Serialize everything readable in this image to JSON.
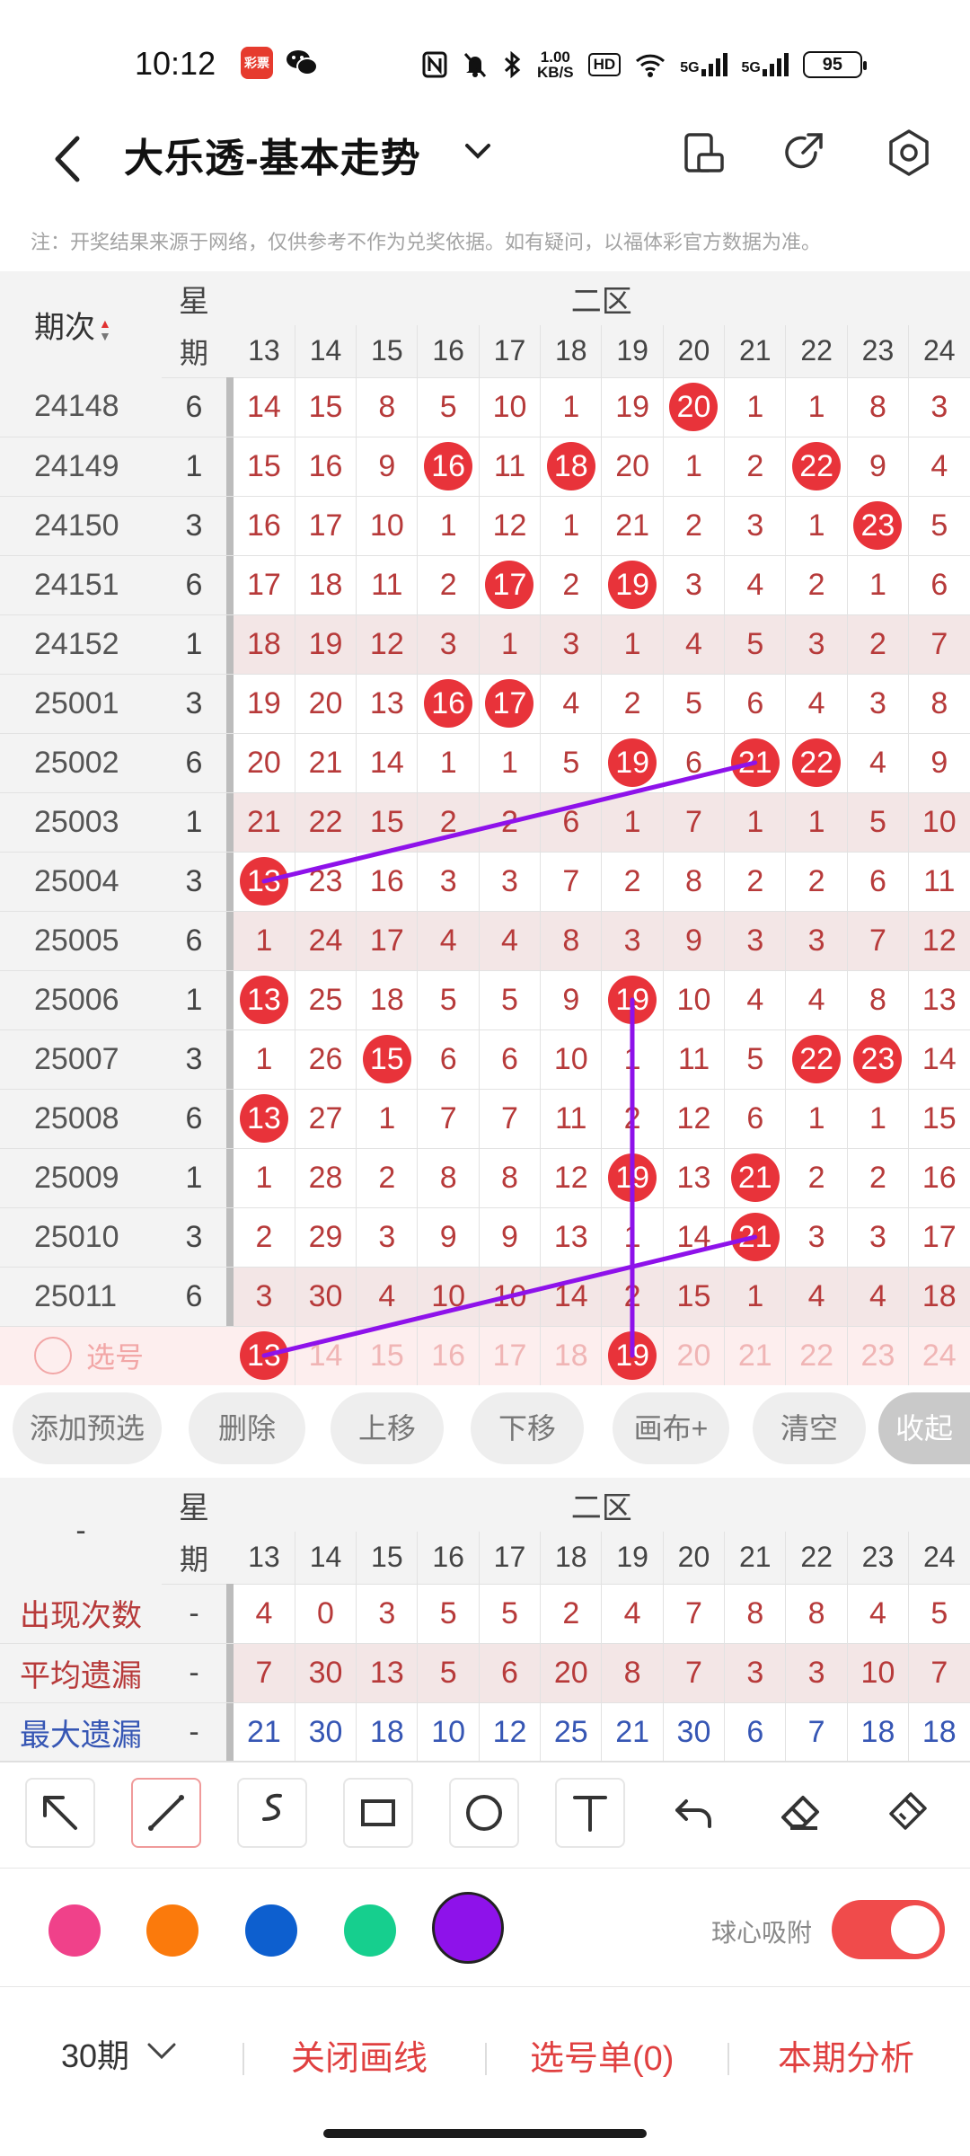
{
  "status": {
    "time": "10:12",
    "speed": "1.00",
    "speed_unit": "KB/S",
    "hd": "HD",
    "net1": "5G",
    "net2": "5G",
    "battery": "95",
    "app_icon_text": "彩票"
  },
  "header": {
    "title": "大乐透-基本走势"
  },
  "note": "注：开奖结果来源于网络，仅供参考不作为兑奖依据。如有疑问，以福体彩官方数据为准。",
  "grid": {
    "issue_header": "期次",
    "week_header_1": "星",
    "week_header_2": "期",
    "zone": "二区",
    "columns": [
      "13",
      "14",
      "15",
      "16",
      "17",
      "18",
      "19",
      "20",
      "21",
      "22",
      "23",
      "24"
    ],
    "rows": [
      {
        "issue": "24148",
        "week": "6",
        "shade": false,
        "cells": [
          "14",
          "15",
          "8",
          "5",
          "10",
          "1",
          "19",
          "20",
          "1",
          "1",
          "8",
          "3"
        ],
        "hits": [
          7
        ]
      },
      {
        "issue": "24149",
        "week": "1",
        "shade": false,
        "cells": [
          "15",
          "16",
          "9",
          "16",
          "11",
          "18",
          "20",
          "1",
          "2",
          "22",
          "9",
          "4"
        ],
        "hits": [
          3,
          5,
          9
        ]
      },
      {
        "issue": "24150",
        "week": "3",
        "shade": false,
        "cells": [
          "16",
          "17",
          "10",
          "1",
          "12",
          "1",
          "21",
          "2",
          "3",
          "1",
          "23",
          "5"
        ],
        "hits": [
          10
        ]
      },
      {
        "issue": "24151",
        "week": "6",
        "shade": false,
        "cells": [
          "17",
          "18",
          "11",
          "2",
          "17",
          "2",
          "19",
          "3",
          "4",
          "2",
          "1",
          "6"
        ],
        "hits": [
          4,
          6
        ]
      },
      {
        "issue": "24152",
        "week": "1",
        "shade": true,
        "cells": [
          "18",
          "19",
          "12",
          "3",
          "1",
          "3",
          "1",
          "4",
          "5",
          "3",
          "2",
          "7"
        ],
        "hits": []
      },
      {
        "issue": "25001",
        "week": "3",
        "shade": false,
        "cells": [
          "19",
          "20",
          "13",
          "16",
          "17",
          "4",
          "2",
          "5",
          "6",
          "4",
          "3",
          "8"
        ],
        "hits": [
          3,
          4
        ]
      },
      {
        "issue": "25002",
        "week": "6",
        "shade": false,
        "cells": [
          "20",
          "21",
          "14",
          "1",
          "1",
          "5",
          "19",
          "6",
          "21",
          "22",
          "4",
          "9"
        ],
        "hits": [
          6,
          8,
          9
        ]
      },
      {
        "issue": "25003",
        "week": "1",
        "shade": true,
        "cells": [
          "21",
          "22",
          "15",
          "2",
          "2",
          "6",
          "1",
          "7",
          "1",
          "1",
          "5",
          "10"
        ],
        "hits": []
      },
      {
        "issue": "25004",
        "week": "3",
        "shade": false,
        "cells": [
          "13",
          "23",
          "16",
          "3",
          "3",
          "7",
          "2",
          "8",
          "2",
          "2",
          "6",
          "11"
        ],
        "hits": [
          0
        ]
      },
      {
        "issue": "25005",
        "week": "6",
        "shade": true,
        "cells": [
          "1",
          "24",
          "17",
          "4",
          "4",
          "8",
          "3",
          "9",
          "3",
          "3",
          "7",
          "12"
        ],
        "hits": []
      },
      {
        "issue": "25006",
        "week": "1",
        "shade": false,
        "cells": [
          "13",
          "25",
          "18",
          "5",
          "5",
          "9",
          "19",
          "10",
          "4",
          "4",
          "8",
          "13"
        ],
        "hits": [
          0,
          6
        ]
      },
      {
        "issue": "25007",
        "week": "3",
        "shade": false,
        "cells": [
          "1",
          "26",
          "15",
          "6",
          "6",
          "10",
          "1",
          "11",
          "5",
          "22",
          "23",
          "14"
        ],
        "hits": [
          2,
          9,
          10
        ]
      },
      {
        "issue": "25008",
        "week": "6",
        "shade": false,
        "cells": [
          "13",
          "27",
          "1",
          "7",
          "7",
          "11",
          "2",
          "12",
          "6",
          "1",
          "1",
          "15"
        ],
        "hits": [
          0
        ]
      },
      {
        "issue": "25009",
        "week": "1",
        "shade": false,
        "cells": [
          "1",
          "28",
          "2",
          "8",
          "8",
          "12",
          "19",
          "13",
          "21",
          "2",
          "2",
          "16"
        ],
        "hits": [
          6,
          8
        ]
      },
      {
        "issue": "25010",
        "week": "3",
        "shade": false,
        "cells": [
          "2",
          "29",
          "3",
          "9",
          "9",
          "13",
          "1",
          "14",
          "21",
          "3",
          "3",
          "17"
        ],
        "hits": [
          8
        ]
      },
      {
        "issue": "25011",
        "week": "6",
        "shade": true,
        "cells": [
          "3",
          "30",
          "4",
          "10",
          "10",
          "14",
          "2",
          "15",
          "1",
          "4",
          "4",
          "18"
        ],
        "hits": []
      }
    ],
    "pick_row": {
      "label": "选号",
      "cells": [
        "13",
        "14",
        "15",
        "16",
        "17",
        "18",
        "19",
        "20",
        "21",
        "22",
        "23",
        "24"
      ],
      "hits": [
        0,
        6
      ]
    }
  },
  "actions": [
    "添加预选",
    "删除",
    "上移",
    "下移",
    "画布+",
    "清空",
    "收起"
  ],
  "stats": {
    "issue_header": "-",
    "week_header_1": "星",
    "week_header_2": "期",
    "zone": "二区",
    "columns": [
      "13",
      "14",
      "15",
      "16",
      "17",
      "18",
      "19",
      "20",
      "21",
      "22",
      "23",
      "24"
    ],
    "rows": [
      {
        "label": "出现次数",
        "week": "-",
        "color": "red",
        "values": [
          "4",
          "0",
          "3",
          "5",
          "5",
          "2",
          "4",
          "7",
          "8",
          "8",
          "4",
          "5"
        ]
      },
      {
        "label": "平均遗漏",
        "week": "-",
        "color": "red",
        "values": [
          "7",
          "30",
          "13",
          "5",
          "6",
          "20",
          "8",
          "7",
          "3",
          "3",
          "10",
          "7"
        ]
      },
      {
        "label": "最大遗漏",
        "week": "-",
        "color": "blue",
        "values": [
          "21",
          "30",
          "18",
          "10",
          "12",
          "25",
          "21",
          "30",
          "6",
          "7",
          "18",
          "18"
        ]
      }
    ]
  },
  "tools": [
    "arrow-tool-icon",
    "line-tool-icon",
    "curve-tool-icon",
    "rectangle-tool-icon",
    "circle-tool-icon",
    "text-tool-icon",
    "undo-icon",
    "eraser-icon",
    "clear-brush-icon"
  ],
  "colors": {
    "swatches": [
      "#f0418a",
      "#fb7a0c",
      "#0d5fcf",
      "#16cf8e",
      "#8e12ea"
    ],
    "selected": 4,
    "line_color": "#8e12ea"
  },
  "snap_label": "球心吸附",
  "bottom": {
    "period": "30期",
    "close_lines": "关闭画线",
    "pick_list": "选号单(0)",
    "analysis": "本期分析"
  }
}
